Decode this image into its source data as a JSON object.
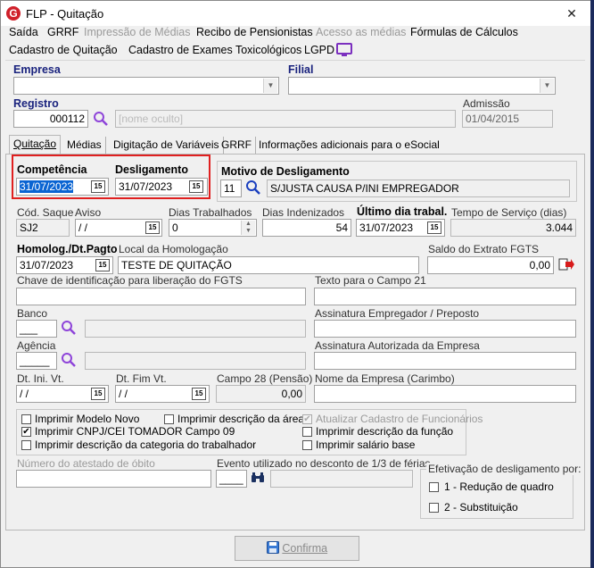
{
  "window": {
    "title": "FLP - Quitação",
    "app_icon": "G"
  },
  "menu_row1": [
    "Saída",
    "GRRF",
    "Impressão de Médias",
    "Recibo de Pensionistas",
    "Acesso as médias",
    "Fórmulas de Cálculos"
  ],
  "menu_row2": [
    "Cadastro de Quitação",
    "Cadastro de Exames Toxicológicos",
    "LGPD"
  ],
  "labels": {
    "empresa": "Empresa",
    "filial": "Filial",
    "registro": "Registro",
    "admissao": "Admissão",
    "competencia": "Competência",
    "desligamento": "Desligamento",
    "motivo": "Motivo de Desligamento",
    "cod_saque": "Cód. Saque",
    "aviso": "Aviso",
    "dias_trab": "Dias Trabalhados",
    "dias_indeniz": "Dias Indenizados",
    "ultimo_dia": "Último dia trabal.",
    "tempo_servico": "Tempo de Serviço (dias)",
    "homolog": "Homolog./Dt.Pagto",
    "local_homolog": "Local da Homologação",
    "saldo_fgts": "Saldo do Extrato FGTS",
    "chave_fgts": "Chave de identificação para liberação do FGTS",
    "texto_campo21": "Texto para o Campo 21",
    "banco": "Banco",
    "assin_empregador": "Assinatura Empregador / Preposto",
    "agencia": "Agência",
    "assin_autorizada": "Assinatura Autorizada da Empresa",
    "dt_ini_vt": "Dt. Ini. Vt.",
    "dt_fim_vt": "Dt. Fim Vt.",
    "campo28": "Campo 28 (Pensão)",
    "nome_empresa": "Nome da Empresa (Carimbo)",
    "atestado_obito": "Número do atestado de óbito",
    "evento_desconto": "Evento utilizado no desconto de 1/3 de férias",
    "efetivacao": "Efetivação de desligamento por:"
  },
  "values": {
    "registro": "000112",
    "registro_nome": "[nome oculto]",
    "admissao": "01/04/2015",
    "competencia": "31/07/2023",
    "desligamento": "31/07/2023",
    "motivo_cod": "11",
    "motivo_desc": "S/JUSTA CAUSA P/INI EMPREGADOR",
    "cod_saque": "SJ2",
    "aviso": " / /",
    "dias_trab": "0",
    "dias_indeniz": "54",
    "ultimo_dia": "31/07/2023",
    "tempo_servico": "3.044",
    "homolog": "31/07/2023",
    "local_homolog": "TESTE DE QUITAÇÃO",
    "saldo_fgts": "0,00",
    "banco": "___",
    "agencia": "_____",
    "dt_ini_vt": " / /",
    "dt_fim_vt": " / /",
    "campo28": "0,00",
    "evento": "____"
  },
  "tabs": [
    "Quitação",
    "Médias",
    "Digitação de Variáveis",
    "GRRF",
    "Informações adicionais para o eSocial"
  ],
  "checkboxes": [
    {
      "label": "Imprimir Modelo Novo",
      "checked": false,
      "disabled": false
    },
    {
      "label": "Imprimir descrição da área",
      "checked": false,
      "disabled": false
    },
    {
      "label": "Atualizar Cadastro de Funcionários",
      "checked": true,
      "disabled": true
    },
    {
      "label": "Imprimir CNPJ/CEI TOMADOR Campo 09",
      "checked": true,
      "disabled": false
    },
    {
      "label": "Imprimir descrição da função",
      "checked": false,
      "disabled": false
    },
    {
      "label": "Imprimir descrição da categoria do trabalhador",
      "checked": false,
      "disabled": false
    },
    {
      "label": "Imprimir salário base",
      "checked": false,
      "disabled": false
    }
  ],
  "efetivacao_options": [
    {
      "label": "1 - Redução de quadro",
      "checked": false
    },
    {
      "label": "2 - Substituição",
      "checked": false
    }
  ],
  "buttons": {
    "confirma": "Confirma",
    "calendar_glyph": "15"
  },
  "colors": {
    "accent_blue": "#1a237e",
    "highlight": "#0a64d2",
    "red_box": "#e02020",
    "lgpd_purple": "#7b2fbf"
  }
}
